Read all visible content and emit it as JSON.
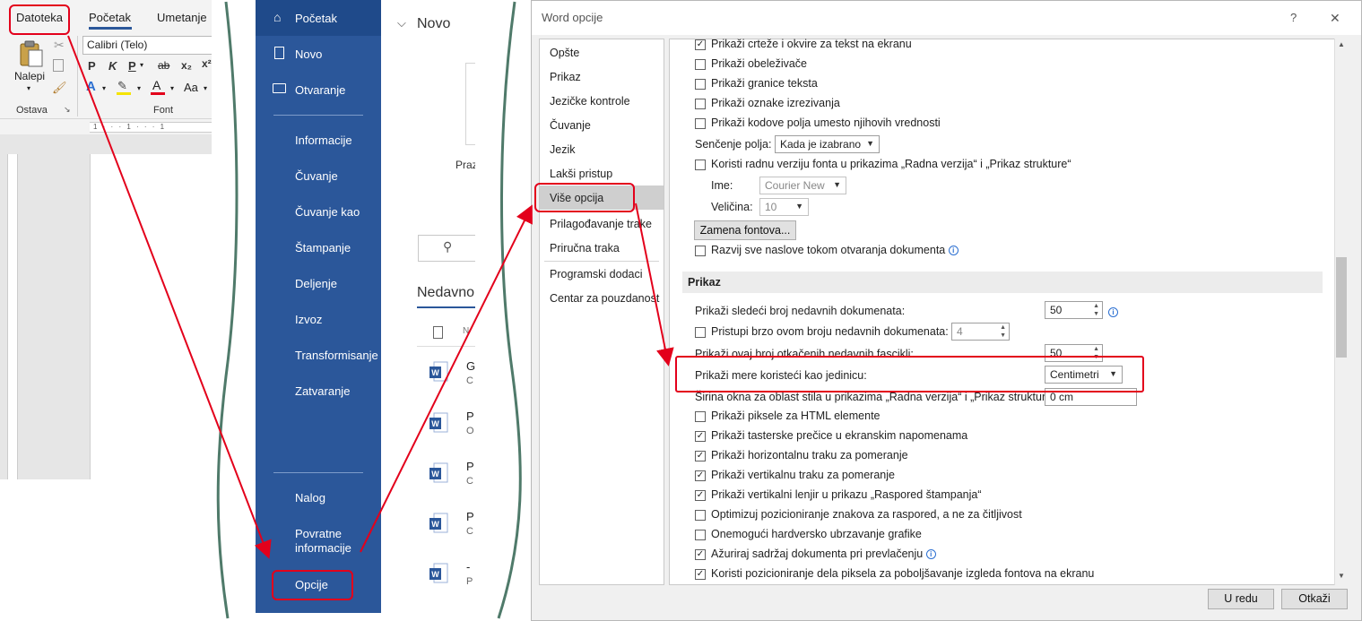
{
  "ribbon": {
    "tabs": [
      "Datoteka",
      "Početak",
      "Umetanje"
    ],
    "font_name": "Calibri (Telo)",
    "paste_label": "Nalepi",
    "group_clipboard": "Ostava",
    "group_font": "Font",
    "format_buttons": [
      "P",
      "K",
      "P",
      "ab",
      "x₂",
      "x²"
    ],
    "ruler_marks": "1 · · · 1 · · · 1"
  },
  "backstage": {
    "home": "Početak",
    "new": "Novo",
    "open": "Otvaranje",
    "info": "Informacije",
    "save": "Čuvanje",
    "save_as": "Čuvanje kao",
    "print": "Štampanje",
    "share": "Deljenje",
    "export": "Izvoz",
    "transform": "Transformisanje",
    "close": "Zatvaranje",
    "account": "Nalog",
    "feedback_line1": "Povratne",
    "feedback_line2": "informacije",
    "options": "Opcije",
    "content_header": "Novo",
    "recent_header": "Nedavno",
    "blank_caption": "Praz",
    "recent_items": [
      {
        "line1": "G",
        "line2": "C"
      },
      {
        "line1": "P",
        "line2": "O"
      },
      {
        "line1": "P",
        "line2": "C"
      },
      {
        "line1": "P",
        "line2": "C"
      },
      {
        "line1": "-",
        "line2": "P"
      }
    ]
  },
  "dialog": {
    "title": "Word opcije",
    "help": "?",
    "close": "✕",
    "categories": [
      "Opšte",
      "Prikaz",
      "Jezičke kontrole",
      "Čuvanje",
      "Jezik",
      "Lakši pristup",
      "Više opcija",
      "Prilagođavanje trake",
      "Priručna traka",
      "Programski dodaci",
      "Centar za pouzdanost"
    ],
    "top_options": [
      {
        "label": "Prikaži crteže i okvire za tekst na ekranu",
        "checked": true
      },
      {
        "label": "Prikaži obeleživače",
        "checked": false
      },
      {
        "label": "Prikaži granice teksta",
        "checked": false
      },
      {
        "label": "Prikaži oznake izrezivanja",
        "checked": false
      },
      {
        "label": "Prikaži kodove polja umesto njihovih vrednosti",
        "checked": false
      }
    ],
    "shading_label": "Senčenje polja:",
    "shading_value": "Kada je izabrano",
    "draft_font_label": "Koristi radnu verziju fonta u prikazima „Radna verzija“ i „Prikaz strukture“",
    "name_label": "Ime:",
    "name_value": "Courier New",
    "size_label": "Veličina:",
    "size_value": "10",
    "font_sub_button": "Zamena fontova...",
    "expand_headings": "Razvij sve naslove tokom otvaranja dokumenta",
    "section_title": "Prikaz",
    "recent_docs_label": "Prikaži sledeći broj nedavnih dokumenata:",
    "recent_docs_value": "50",
    "quick_access_label": "Pristupi brzo ovom broju nedavnih dokumenata:",
    "quick_access_value": "4",
    "unpinned_label": "Prikaži ovaj broj otkačenih nedavnih fascikli:",
    "unpinned_value": "50",
    "units_label": "Prikaži mere koristeći kao jedinicu:",
    "units_value": "Centimetri",
    "style_pane_label": "Širina okna za oblast stila u prikazima „Radna verzija“ i „Prikaz strukture“:",
    "style_pane_value": "0 cm",
    "bottom_options": [
      {
        "label": "Prikaži piksele za HTML elemente",
        "checked": false
      },
      {
        "label": "Prikaži tasterske prečice u ekranskim napomenama",
        "checked": true
      },
      {
        "label": "Prikaži horizontalnu traku za pomeranje",
        "checked": true
      },
      {
        "label": "Prikaži vertikalnu traku za pomeranje",
        "checked": true
      },
      {
        "label": "Prikaži vertikalni lenjir u prikazu „Raspored štampanja“",
        "checked": true
      },
      {
        "label": "Optimizuj pozicioniranje znakova za raspored, a ne za čitljivost",
        "checked": false
      },
      {
        "label": "Onemogući hardversko ubrzavanje grafike",
        "checked": false
      },
      {
        "label": "Ažuriraj sadržaj dokumenta pri prevlačenju",
        "checked": true
      },
      {
        "label": "Koristi pozicioniranje dela piksela za poboljšavanje izgleda fontova na ekranu",
        "checked": true
      }
    ],
    "ok": "U redu",
    "cancel": "Otkaži"
  },
  "colors": {
    "accent_blue": "#2b579a",
    "highlight_red": "#e3001b",
    "separator_green": "#4f7a6a"
  }
}
